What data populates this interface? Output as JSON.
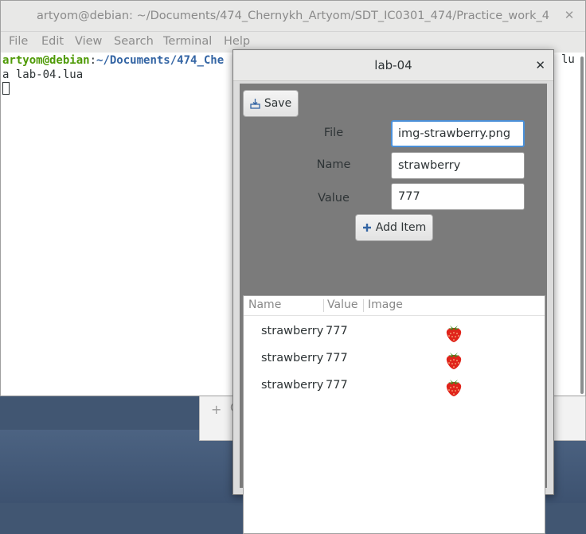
{
  "terminal": {
    "title": "artyom@debian: ~/Documents/474_Chernykh_Artyom/SDT_IC0301_474/Practice_work_4",
    "menu": [
      "File",
      "Edit",
      "View",
      "Search",
      "Terminal",
      "Help"
    ],
    "prompt_user": "artyom@debian",
    "prompt_sep": ":",
    "prompt_path": "~/Documents/474_Che",
    "command_line": "a lab-04.lua",
    "right_text": "lu"
  },
  "background_strip": {
    "plus": "+",
    "text": "C"
  },
  "dialog": {
    "title": "lab-04",
    "save_label": "Save",
    "file_label": "File",
    "file_value": "img-strawberry.png",
    "name_label": "Name",
    "name_value": "strawberry",
    "value_label": "Value",
    "value_value": "777",
    "add_label": "Add Item",
    "columns": [
      "Name",
      "Value",
      "Image"
    ],
    "rows": [
      {
        "name": "strawberry",
        "value": "777",
        "image": "strawberry-icon"
      },
      {
        "name": "strawberry",
        "value": "777",
        "image": "strawberry-icon"
      },
      {
        "name": "strawberry",
        "value": "777",
        "image": "strawberry-icon"
      }
    ]
  },
  "colors": {
    "prompt_user": "#4e9a06",
    "prompt_path": "#3465a4",
    "dialog_body": "#7b7b7b",
    "focus": "#4a90d9"
  }
}
